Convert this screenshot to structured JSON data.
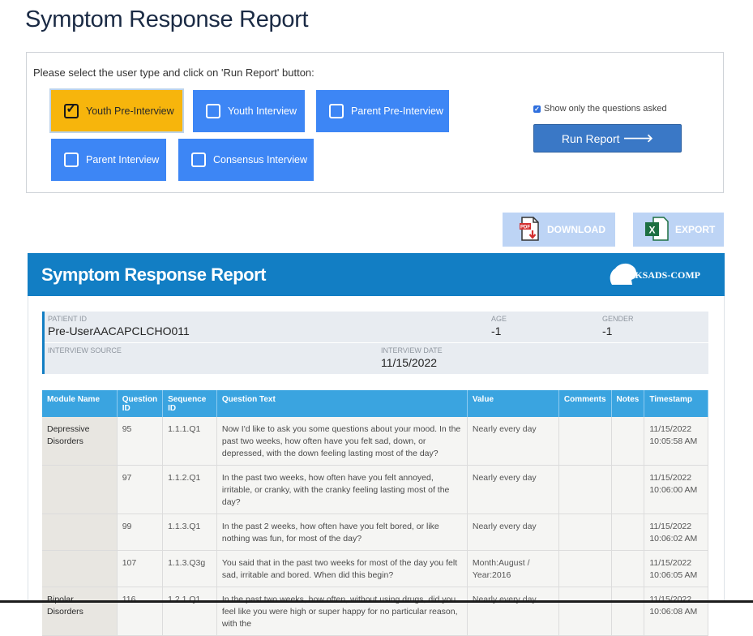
{
  "page_title": "Symptom Response Report",
  "selection": {
    "prompt": "Please select the user type and click on 'Run Report' button:",
    "user_types": [
      {
        "label": "Youth Pre-Interview",
        "selected": true
      },
      {
        "label": "Youth Interview",
        "selected": false
      },
      {
        "label": "Parent Pre-Interview",
        "selected": false
      },
      {
        "label": "Parent Interview",
        "selected": false
      },
      {
        "label": "Consensus Interview",
        "selected": false
      }
    ],
    "show_only_label": "Show only the questions asked",
    "show_only_checked": true,
    "run_report_label": "Run Report"
  },
  "actions": {
    "download_label": "DOWNLOAD",
    "export_label": "EXPORT"
  },
  "report": {
    "title": "Symptom Response Report",
    "logo_text": "KSADS-COMP",
    "patient": {
      "patient_id_label": "PATIENT ID",
      "patient_id": "Pre-UserAACAPCLCHO011",
      "age_label": "AGE",
      "age": "-1",
      "gender_label": "GENDER",
      "gender": "-1",
      "source_label": "INTERVIEW SOURCE",
      "source": "",
      "date_label": "INTERVIEW DATE",
      "date": "11/15/2022"
    },
    "columns": [
      "Module Name",
      "Question ID",
      "Sequence ID",
      "Question Text",
      "Value",
      "Comments",
      "Notes",
      "Timestamp"
    ],
    "rows": [
      {
        "module": "Depressive Disorders",
        "qid": "95",
        "seq": "1.1.1.Q1",
        "text": "Now I'd like to ask you some questions about your mood. In the past two weeks, how often have you felt sad, down, or depressed, with the down feeling lasting most of the day?",
        "value": "Nearly every day",
        "comments": "",
        "notes": "",
        "timestamp": "11/15/2022 10:05:58 AM"
      },
      {
        "module": "",
        "qid": "97",
        "seq": "1.1.2.Q1",
        "text": "In the past two weeks, how often have you felt annoyed, irritable, or cranky, with the cranky feeling lasting most of the day?",
        "value": "Nearly every day",
        "comments": "",
        "notes": "",
        "timestamp": "11/15/2022 10:06:00 AM"
      },
      {
        "module": "",
        "qid": "99",
        "seq": "1.1.3.Q1",
        "text": "In the past 2 weeks, how often have you felt bored, or like nothing was fun, for most of the day?",
        "value": "Nearly every day",
        "comments": "",
        "notes": "",
        "timestamp": "11/15/2022 10:06:02 AM"
      },
      {
        "module": "",
        "qid": "107",
        "seq": "1.1.3.Q3g",
        "text": "You said that in the past two weeks for most of the day you felt sad, irritable and bored. When did this begin?",
        "value": "Month:August / Year:2016",
        "comments": "",
        "notes": "",
        "timestamp": "11/15/2022 10:06:05 AM"
      },
      {
        "module": "Bipolar Disorders",
        "qid": "116",
        "seq": "1.2.1.Q1",
        "text": "In the past two weeks, how often, without using drugs, did you feel like you were high or super happy for no particular reason, with the",
        "value": "Nearly every day",
        "comments": "",
        "notes": "",
        "timestamp": "11/15/2022 10:06:08 AM"
      }
    ]
  },
  "colors": {
    "selected_button": "#f7b50c",
    "unselected_button": "#3d86f5",
    "report_header": "#127ec4",
    "table_header": "#3aa4e0"
  }
}
